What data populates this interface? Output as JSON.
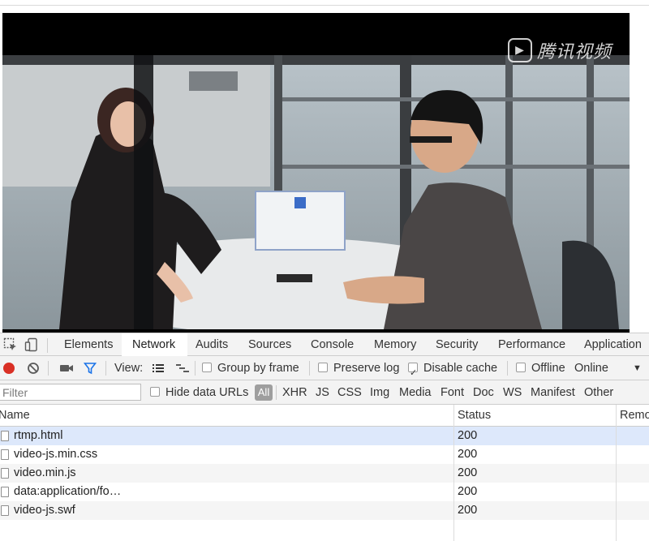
{
  "video": {
    "watermark": "腾讯视频"
  },
  "devtools": {
    "tabs": [
      {
        "label": "Elements"
      },
      {
        "label": "Network",
        "active": true
      },
      {
        "label": "Audits"
      },
      {
        "label": "Sources"
      },
      {
        "label": "Console"
      },
      {
        "label": "Memory"
      },
      {
        "label": "Security"
      },
      {
        "label": "Performance"
      },
      {
        "label": "Application"
      }
    ],
    "toolbar": {
      "view_label": "View:",
      "group_by_frame": {
        "label": "Group by frame",
        "checked": false
      },
      "preserve_log": {
        "label": "Preserve log",
        "checked": false
      },
      "disable_cache": {
        "label": "Disable cache",
        "checked": true
      },
      "offline": {
        "label": "Offline",
        "checked": false
      },
      "throttle_value": "Online"
    },
    "filterbar": {
      "placeholder": "Filter",
      "hide_data_urls": {
        "label": "Hide data URLs",
        "checked": false
      },
      "types": [
        "All",
        "XHR",
        "JS",
        "CSS",
        "Img",
        "Media",
        "Font",
        "Doc",
        "WS",
        "Manifest",
        "Other"
      ]
    },
    "columns": {
      "name": "Name",
      "status": "Status",
      "remote": "Remo"
    },
    "rows": [
      {
        "name": "rtmp.html",
        "status": "200"
      },
      {
        "name": "video-js.min.css",
        "status": "200"
      },
      {
        "name": "video.min.js",
        "status": "200"
      },
      {
        "name": "data:application/fo…",
        "status": "200"
      },
      {
        "name": "video-js.swf",
        "status": "200"
      }
    ],
    "colors": {
      "record": "#d93025",
      "filter_active": "#1a73e8",
      "selected_row": "#dde8fb"
    }
  }
}
